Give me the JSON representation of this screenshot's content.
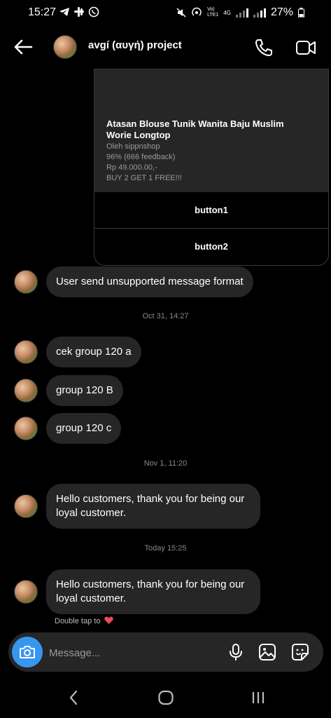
{
  "status": {
    "time": "15:27",
    "net_top": "Vo)",
    "net_bottom": "LTE1",
    "net_type": "4G",
    "battery": "27%"
  },
  "header": {
    "title": "avgí (αυγή) project"
  },
  "product_card": {
    "title": "Atasan Blouse Tunik Wanita Baju Muslim Worie Longtop",
    "seller": "Oleh sippnshop",
    "rating": "96% (666 feedback)",
    "price": "Rp 49.000.00,-",
    "promo": "BUY 2 GET 1 FREE!!!",
    "button1": "button1",
    "button2": "button2"
  },
  "messages": [
    {
      "text": "User send unsupported message format"
    },
    {
      "text": "cek group 120 a"
    },
    {
      "text": "group 120 B"
    },
    {
      "text": "group 120 c"
    },
    {
      "text": "Hello customers, thank you for being our loyal customer."
    },
    {
      "text": "Hello customers, thank you for being our loyal customer."
    }
  ],
  "timestamps": [
    "Oct 31, 14:27",
    "Nov 1, 11:20",
    "Today 15:25"
  ],
  "hint": "Double tap to",
  "composer": {
    "placeholder": "Message..."
  },
  "colors": {
    "accent": "#3797f0",
    "bubble": "#262626",
    "heart": "#ed4956"
  }
}
